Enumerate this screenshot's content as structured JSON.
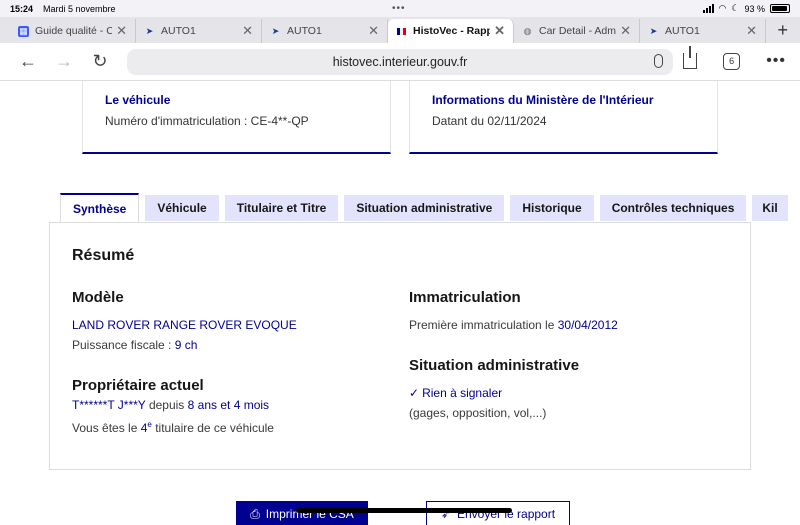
{
  "status": {
    "time": "15:24",
    "date": "Mardi 5 novembre",
    "battery": "93 %",
    "battery_level": 0.93
  },
  "browser_tabs": [
    {
      "title": "Guide qualité - C",
      "icon": "doc-icon",
      "active": false
    },
    {
      "title": "AUTO1",
      "icon": "auto1-icon",
      "active": false
    },
    {
      "title": "AUTO1",
      "icon": "auto1-icon",
      "active": false
    },
    {
      "title": "HistoVec - Rapp",
      "icon": "flag-icon",
      "active": true
    },
    {
      "title": "Car Detail - Adm",
      "icon": "globe-icon",
      "active": false
    },
    {
      "title": "AUTO1",
      "icon": "auto1-icon",
      "active": false
    }
  ],
  "toolbar": {
    "url": "histovec.interieur.gouv.fr",
    "tab_count": "6"
  },
  "cards": {
    "vehicle": {
      "title": "Le véhicule",
      "text": "Numéro d'immatriculation : CE-4**-QP"
    },
    "ministry": {
      "title": "Informations du Ministère de l'Intérieur",
      "text": "Datant du 02/11/2024"
    }
  },
  "page_tabs": [
    "Synthèse",
    "Véhicule",
    "Titulaire et Titre",
    "Situation administrative",
    "Historique",
    "Contrôles techniques",
    "Kil"
  ],
  "summary": {
    "heading": "Résumé",
    "model": {
      "heading": "Modèle",
      "name": "LAND ROVER RANGE ROVER EVOQUE",
      "power_label": "Puissance fiscale :",
      "power_value": "9 ch"
    },
    "owner": {
      "heading": "Propriétaire actuel",
      "name": "T******T J***Y",
      "since_label": "depuis",
      "since_value": "8 ans et 4 mois",
      "rank_prefix": "Vous êtes le",
      "rank_num": "4",
      "rank_sup": "e",
      "rank_suffix": "titulaire de ce véhicule"
    },
    "registration": {
      "heading": "Immatriculation",
      "label": "Première immatriculation le",
      "date": "30/04/2012"
    },
    "admin": {
      "heading": "Situation administrative",
      "status": "Rien à signaler",
      "detail": "(gages, opposition, vol,...)"
    }
  },
  "actions": {
    "print": "Imprimer le CSA",
    "send": "Envoyer le rapport"
  },
  "colors": {
    "primary": "#000091",
    "tab_bg": "#e3e3fd"
  }
}
